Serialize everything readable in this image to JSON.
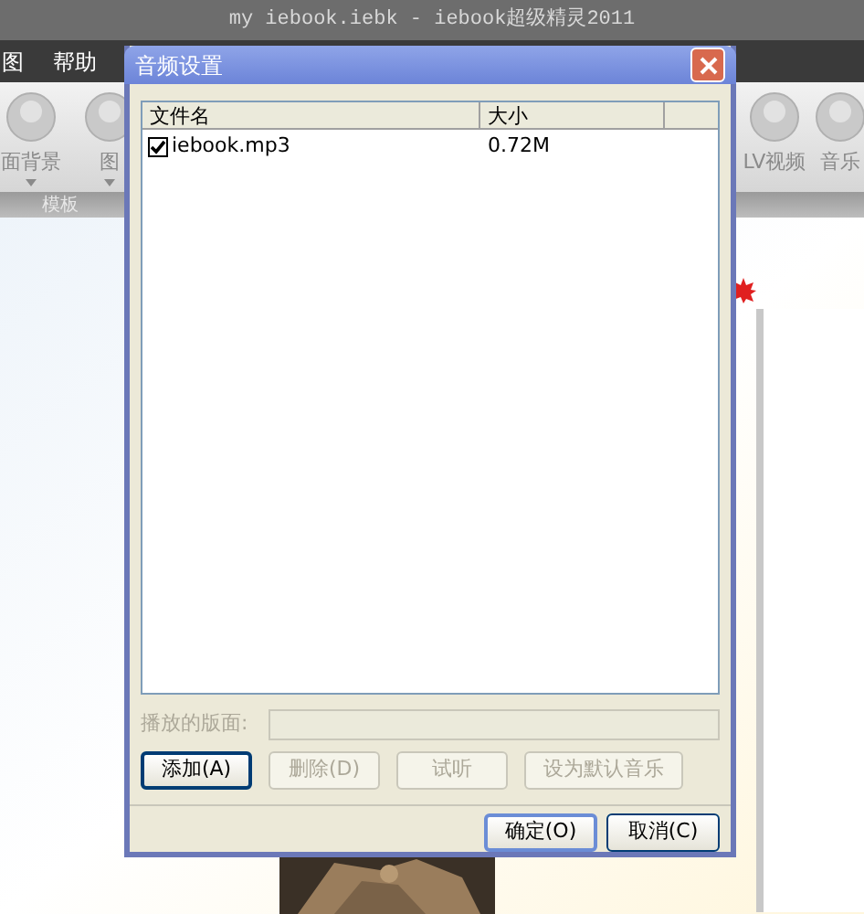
{
  "app": {
    "title": "my iebook.iebk - iebook超级精灵2011",
    "menu": [
      "图",
      "帮助"
    ],
    "ribbon_left": [
      {
        "label": "面背景",
        "dropdown": true
      },
      {
        "label": "图",
        "dropdown": true
      }
    ],
    "ribbon_right": [
      {
        "label": "LV视频",
        "dropdown": false
      },
      {
        "label": "音乐",
        "dropdown": false
      }
    ],
    "group_label": "模板"
  },
  "dialog": {
    "title": "音频设置",
    "columns": [
      "文件名",
      "大小"
    ],
    "files": [
      {
        "name": "iebook.mp3",
        "size": "0.72M",
        "checked": true
      }
    ],
    "page_label": "播放的版面:",
    "buttons": [
      {
        "label": "添加(A)",
        "disabled": false
      },
      {
        "label": "删除(D)",
        "disabled": true
      },
      {
        "label": "试听",
        "disabled": true
      },
      {
        "label": "设为默认音乐",
        "disabled": true
      }
    ],
    "ok": "确定(O)",
    "cancel": "取消(C)"
  }
}
